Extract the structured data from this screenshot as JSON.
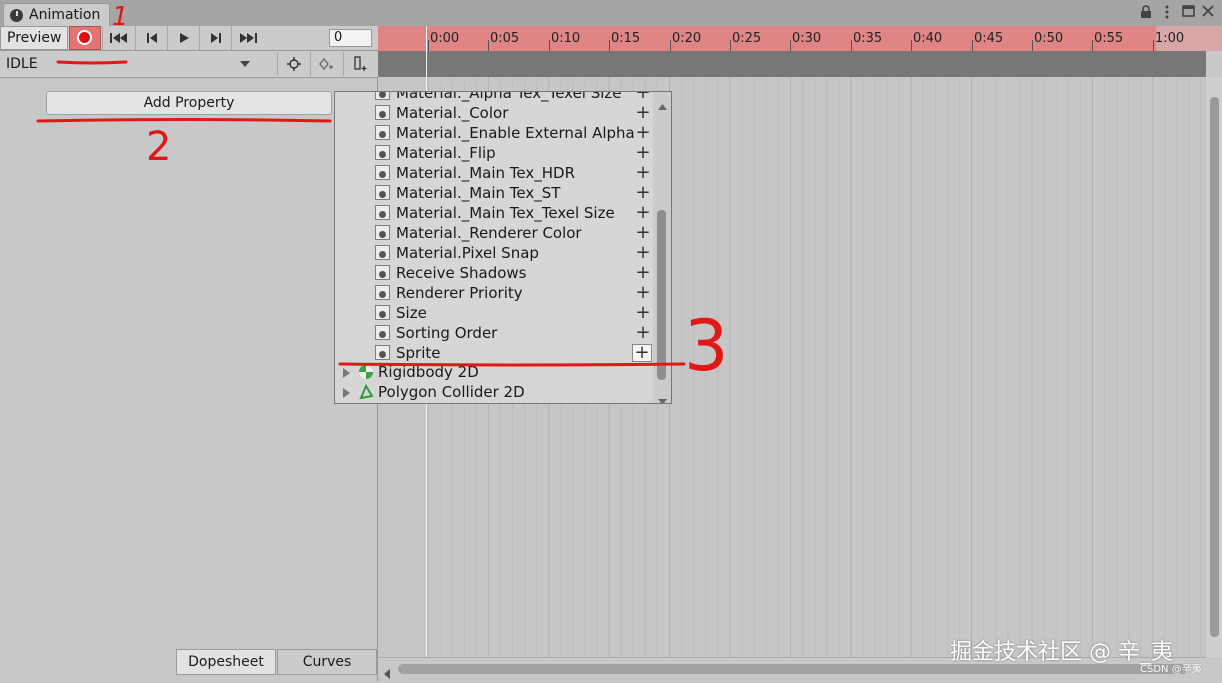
{
  "window": {
    "tab_title": "Animation",
    "controls": [
      "lock-icon",
      "more-icon",
      "maximize-icon",
      "close-icon"
    ]
  },
  "toolbar": {
    "preview_label": "Preview",
    "frame_value": "0"
  },
  "clip": {
    "selected": "IDLE"
  },
  "left_panel": {
    "add_property_label": "Add Property",
    "tabs": {
      "dopesheet": "Dopesheet",
      "curves": "Curves"
    }
  },
  "timeline": {
    "ticks": [
      "0:00",
      "0:05",
      "0:10",
      "0:15",
      "0:20",
      "0:25",
      "0:30",
      "0:35",
      "0:40",
      "0:45",
      "0:50",
      "0:55",
      "1:00"
    ],
    "ruler_color": "#e08585"
  },
  "dropdown": {
    "items": [
      "Material._Alpha Tex_Texel Size",
      "Material._Color",
      "Material._Enable External Alpha",
      "Material._Flip",
      "Material._Main Tex_HDR",
      "Material._Main Tex_ST",
      "Material._Main Tex_Texel Size",
      "Material._Renderer Color",
      "Material.Pixel Snap",
      "Receive Shadows",
      "Renderer Priority",
      "Size",
      "Sorting Order",
      "Sprite"
    ],
    "groups": [
      "Rigidbody 2D",
      "Polygon Collider 2D"
    ]
  },
  "annotations": {
    "mark1": "1",
    "mark2": "2",
    "mark3": "3"
  },
  "watermark": {
    "main": "掘金技术社区 @ 辛_夷",
    "small": "CSDN @辛夷"
  }
}
